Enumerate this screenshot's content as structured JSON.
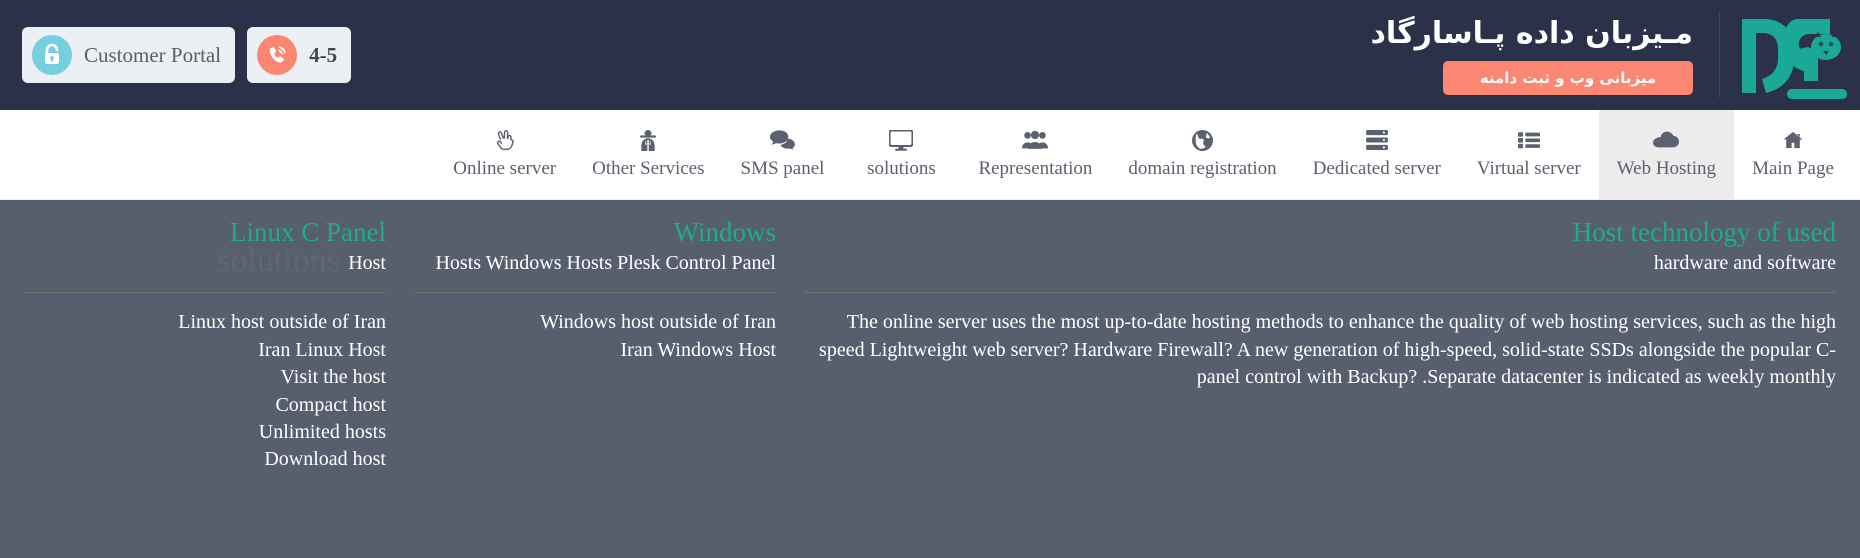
{
  "header": {
    "portal_button": {
      "label": "Customer Portal",
      "icon": "lock-icon"
    },
    "phone_button": {
      "label": "4-5",
      "icon": "phone-icon"
    },
    "brand_title": "مـیزبان داده پـاسارگاد",
    "brand_badge": "میزبانی وب و ثبت دامنه",
    "logo": "pasargad-lion-logo",
    "colors": {
      "header_bg": "#2b3148",
      "lock_icon_bg": "#76cede",
      "phone_icon_bg": "#fb8672",
      "badge_bg": "#fb8672",
      "logo_teal": "#1aa897"
    }
  },
  "nav": {
    "items": [
      {
        "label": "Main Page",
        "icon": "home-icon",
        "active": false
      },
      {
        "label": "Web Hosting",
        "icon": "cloud-icon",
        "active": true
      },
      {
        "label": "Virtual server",
        "icon": "list-icon",
        "active": false
      },
      {
        "label": "Dedicated server",
        "icon": "server-icon",
        "active": false
      },
      {
        "label": "domain registration",
        "icon": "globe-icon",
        "active": false
      },
      {
        "label": "Representation",
        "icon": "users-icon",
        "active": false
      },
      {
        "label": "solutions",
        "icon": "monitor-icon",
        "active": false
      },
      {
        "label": "SMS panel",
        "icon": "comments-icon",
        "active": false
      },
      {
        "label": "Other Services",
        "icon": "secret-agent-icon",
        "active": false
      },
      {
        "label": "Online server",
        "icon": "hand-peace-icon",
        "active": false
      }
    ]
  },
  "content": {
    "accent_color": "#1eab8e",
    "background": "#575e6e",
    "columns": [
      {
        "title": "Linux C Panel",
        "subtitle": "Host",
        "watermark": "solutions",
        "items": [
          "Linux host outside of Iran",
          "Iran Linux Host",
          "Visit the host",
          "Compact host",
          "Unlimited hosts",
          "Download host"
        ]
      },
      {
        "title": "Windows",
        "subtitle": "Hosts Windows Hosts Plesk Control Panel",
        "watermark": "",
        "items": [
          "Windows host outside of Iran",
          "Iran Windows Host"
        ]
      }
    ],
    "about": {
      "title": "Host technology of used",
      "subtitle": "hardware and software",
      "paragraph": "The online server uses the most up-to-date hosting methods to enhance the quality of web hosting services, such as the high speed Lightweight web server? Hardware Firewall? A new generation of high-speed, solid-state SSDs alongside the popular C-panel control with Backup? .Separate datacenter is indicated as weekly monthly"
    }
  }
}
